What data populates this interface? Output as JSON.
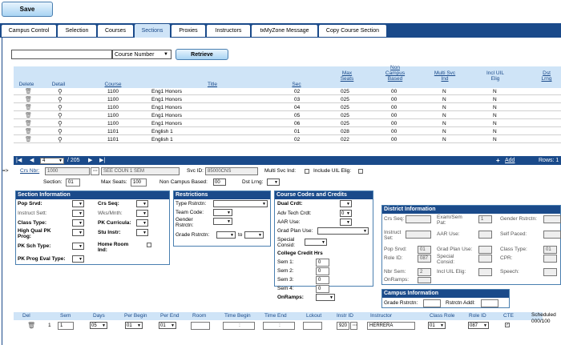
{
  "toolbar": {
    "save_label": "Save"
  },
  "tabs": [
    "Campus Control",
    "Selection",
    "Courses",
    "Sections",
    "Proxies",
    "Instructors",
    "txMyZone Message",
    "Copy Course Section"
  ],
  "filter": {
    "search_value": "",
    "field_select": "Course Number",
    "retrieve_label": "Retrieve"
  },
  "grid": {
    "headers": {
      "delete": "Delete",
      "detail": "Detail",
      "course": "Course",
      "title": "Title",
      "sec": "Sec",
      "max_seats_1": "Max",
      "max_seats_2": "Seats",
      "non_campus_1": "Non",
      "non_campus_2": "Campus",
      "non_campus_3": "Based",
      "multi_svc_1": "Multi Svc",
      "multi_svc_2": "Ind",
      "incl_uil_1": "Incl UIL",
      "incl_uil_2": "Elig",
      "dst_lrng_1": "Dst",
      "dst_lrng_2": "Lrng"
    },
    "rows": [
      {
        "course": "1100",
        "title": "Eng1 Honors",
        "sec": "02",
        "max": "025",
        "noncampus": "00",
        "multisvc": "N",
        "incluil": "N"
      },
      {
        "course": "1100",
        "title": "Eng1 Honors",
        "sec": "03",
        "max": "025",
        "noncampus": "00",
        "multisvc": "N",
        "incluil": "N"
      },
      {
        "course": "1100",
        "title": "Eng1 Honors",
        "sec": "04",
        "max": "025",
        "noncampus": "00",
        "multisvc": "N",
        "incluil": "N"
      },
      {
        "course": "1100",
        "title": "Eng1 Honors",
        "sec": "05",
        "max": "025",
        "noncampus": "00",
        "multisvc": "N",
        "incluil": "N"
      },
      {
        "course": "1100",
        "title": "Eng1 Honors",
        "sec": "06",
        "max": "025",
        "noncampus": "00",
        "multisvc": "N",
        "incluil": "N"
      },
      {
        "course": "1101",
        "title": "English 1",
        "sec": "01",
        "max": "028",
        "noncampus": "00",
        "multisvc": "N",
        "incluil": "N"
      },
      {
        "course": "1101",
        "title": "English 1",
        "sec": "02",
        "max": "022",
        "noncampus": "00",
        "multisvc": "N",
        "incluil": "N"
      }
    ]
  },
  "pager": {
    "page": "4",
    "of_total": "/ 205",
    "add_label": "Add",
    "rows_label": "Rows: 1"
  },
  "detail": {
    "arrow": "=>",
    "crs_nbr_label": "Crs Nbr:",
    "crs_nbr_value": "1000",
    "course_title_value": "SEE COUN 1 SEM",
    "svc_id_label": "Svc ID:",
    "svc_id_value": "85000CNS",
    "multi_svc_label": "Multi Svc Ind:",
    "incl_uil_label": "Include UIL Elig:",
    "section_label": "Section:",
    "section_value": "01",
    "max_seats_label": "Max Seats:",
    "max_seats_value": "100",
    "non_campus_label": "Non Campus Based:",
    "non_campus_value": "00",
    "dst_lrng_label": "Dst Lrng:"
  },
  "section_info": {
    "title": "Section Information",
    "pop_srvd": "Pop Srvd:",
    "instruct_sett": "Instruct Sett:",
    "class_type": "Class Type:",
    "high_qual_1": "High Qual PK",
    "high_qual_2": "Prog:",
    "pk_sch_type": "PK Sch Type:",
    "pk_prog_eval": "PK Prog Eval Type:",
    "crs_seq": "Crs Seq:",
    "wks_mnth": "Wks/Mnth:",
    "pk_curricula": "PK Curricula:",
    "stu_instr": "Stu Instr:",
    "home_room_1": "Home Room",
    "home_room_2": "Ind:"
  },
  "restrictions": {
    "title": "Restrictions",
    "type_rstrctn": "Type Rstrctn:",
    "team_code": "Team Code:",
    "gender_1": "Gender",
    "gender_2": "Rstrctn:",
    "grade_rstrctn": "Grade Rstrctn:",
    "to": "to"
  },
  "course_codes": {
    "title": "Course Codes and Credits",
    "dual_crdt": "Dual Crdt:",
    "adv_tech": "Adv Tech Crdt:",
    "adv_tech_value": "0",
    "aar_use": "AAR Use:",
    "grad_plan": "Grad Plan Use:",
    "special_1": "Special",
    "special_2": "Consid:",
    "college_credit": "College Credit Hrs",
    "sem1": "Sem 1:",
    "sem2": "Sem 2:",
    "sem3": "Sem 3:",
    "sem4": "Sem 4:",
    "sem1_v": "0",
    "sem2_v": "0",
    "sem3_v": "0",
    "sem4_v": "0",
    "onramps": "OnRamps:"
  },
  "district_info": {
    "title": "District Information",
    "crs_seq": "Crs Seq:",
    "exam_sem_1": "Exam/Sem",
    "exam_sem_2": "Pat:",
    "exam_sem_v": "1",
    "gender_rstrctn": "Gender Rstrctn:",
    "instruct_1": "Instruct",
    "instruct_2": "Set:",
    "aar_use": "AAR Use:",
    "self_paced": "Self Paced:",
    "pop_srvd": "Pop Srvd:",
    "pop_srvd_v": "01",
    "grad_plan": "Grad Plan Use:",
    "class_type": "Class Type:",
    "class_type_v": "01",
    "role_id": "Role ID:",
    "role_id_v": "087",
    "special_1": "Special",
    "special_2": "Consid:",
    "cpr": "CPR:",
    "nbr_sem": "Nbr Sem:",
    "nbr_sem_v": "2",
    "incl_uil": "Incl UIL Elig:",
    "speech": "Speech:",
    "onramps": "OnRamps:"
  },
  "campus_info": {
    "title": "Campus Information",
    "grade_rstrctn": "Grade Rstrctn:",
    "rstrctn_addl": "Rstrctn Addl:"
  },
  "meeting": {
    "headers": {
      "del": "Del",
      "sem": "Sem",
      "days": "Days",
      "per_begin": "Per Begin",
      "per_end": "Per End",
      "room": "Room",
      "time_begin": "Time Begin",
      "time_end": "Time End",
      "lckout": "Lckout",
      "instr_id": "Instr ID",
      "instructor": "Instructor",
      "class_role": "Class Role",
      "role_id": "Role ID",
      "cte": "CTE"
    },
    "row": {
      "num": "1",
      "sem": "1",
      "days": "05",
      "per_begin": "01",
      "per_end": "01",
      "time_begin": ":",
      "time_end": ":",
      "instr_id": "920",
      "instructor": "HERRERA",
      "class_role": "01",
      "role_id": "087"
    },
    "scheduled_1": "Scheduled",
    "scheduled_2": "000/100"
  }
}
